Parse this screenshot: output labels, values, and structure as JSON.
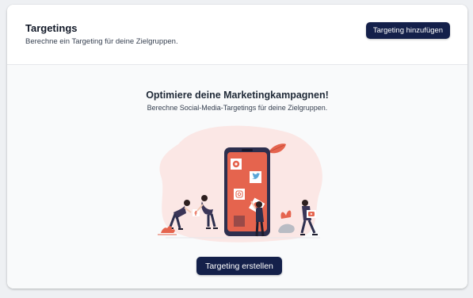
{
  "header": {
    "title": "Targetings",
    "subtitle": "Berechne ein Targeting für deine Zielgruppen.",
    "add_button_label": "Targeting hinzufügen"
  },
  "empty_state": {
    "title": "Optimiere deine Marketingkampagnen!",
    "subtitle": "Berechne Social-Media-Targetings für deine Zielgruppen.",
    "create_button_label": "Targeting erstellen"
  },
  "colors": {
    "primary_button": "#14204a",
    "illustration_accent": "#e5644e",
    "illustration_blob": "#fbe7e5"
  },
  "illustration_icons": [
    "pinterest-icon",
    "twitter-icon",
    "instagram-icon",
    "facebook-icon",
    "youtube-icon",
    "location-pin-icon"
  ]
}
